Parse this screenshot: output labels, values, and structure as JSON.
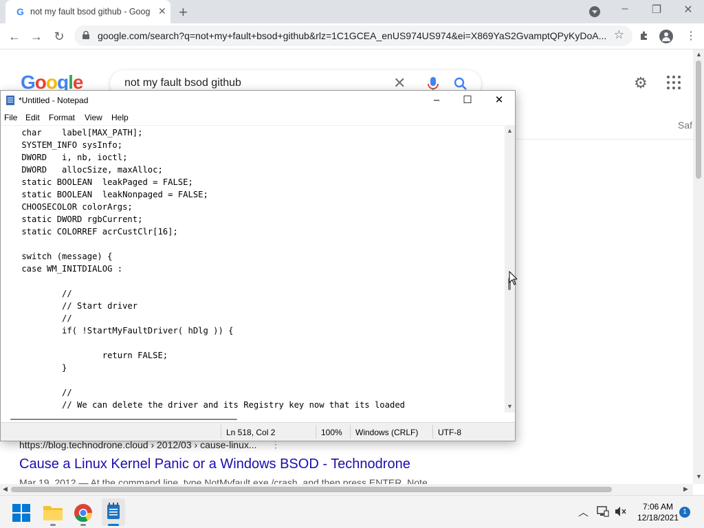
{
  "browser": {
    "tab_title": "not my fault bsod github - Goog",
    "url": "google.com/search?q=not+my+fault+bsod+github&rlz=1C1GCEA_enUS974US974&ei=X869YaS2GvamptQPyKyDoA...",
    "new_tab_label": "+",
    "close_tab_label": "✕"
  },
  "google": {
    "logo_letters": [
      "G",
      "o",
      "o",
      "g",
      "l",
      "e"
    ],
    "logo_colors": [
      "#4285f4",
      "#ea4335",
      "#fbbc05",
      "#4285f4",
      "#34a853",
      "#ea4335"
    ],
    "query": "not my fault bsod github",
    "safesearch_label": "Saf",
    "result": {
      "url": "https://blog.technodrone.cloud › 2012/03 › cause-linux...",
      "more": "⋮",
      "title": "Cause a Linux Kernel Panic or a Windows BSOD - Technodrone",
      "snippet": "Mar 19, 2012 — At the command line, type NotMyfault.exe /crash, and then press ENTER. Note"
    }
  },
  "notepad": {
    "title": "*Untitled - Notepad",
    "menu": [
      "File",
      "Edit",
      "Format",
      "View",
      "Help"
    ],
    "code": "    char    label[MAX_PATH];\n    SYSTEM_INFO sysInfo;\n    DWORD   i, nb, ioctl;\n    DWORD   allocSize, maxAlloc;\n    static BOOLEAN  leakPaged = FALSE;\n    static BOOLEAN  leakNonpaged = FALSE;\n    CHOOSECOLOR colorArgs;\n    static DWORD rgbCurrent;\n    static COLORREF acrCustClr[16];\n\n    switch (message) {\n    case WM_INITDIALOG :\n\n            //\n            // Start driver\n            //\n            if( !StartMyFaultDriver( hDlg )) {\n\n                    return FALSE;\n            }\n\n            //\n            // We can delete the driver and its Registry key now that its loaded\n            //",
    "status": {
      "position": "Ln 518, Col 2",
      "zoom": "100%",
      "line_ending": "Windows (CRLF)",
      "encoding": "UTF-8"
    }
  },
  "taskbar": {
    "time": "7:06 AM",
    "date": "12/18/2021",
    "notification_count": "1"
  },
  "colors": {
    "google_blue": "#4285f4",
    "link_blue": "#1a0dab",
    "windows_blue": "#0078d4"
  }
}
